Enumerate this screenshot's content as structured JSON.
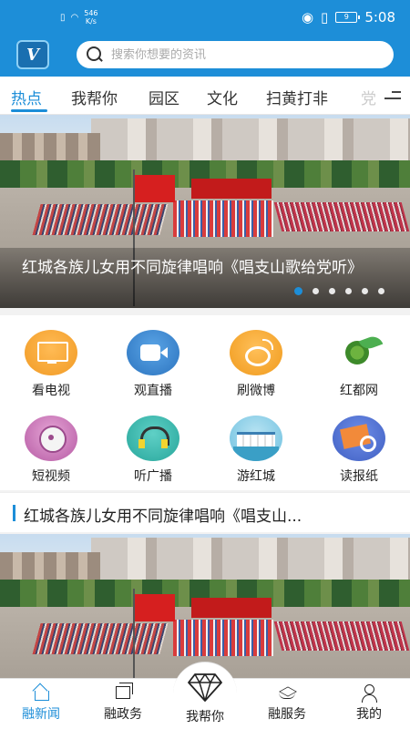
{
  "status_bar": {
    "speed_value": "546",
    "speed_unit": "K/s",
    "battery": "9",
    "time": "5:08"
  },
  "header": {
    "logo_icon": "app-logo",
    "search_placeholder": "搜索你想要的资讯"
  },
  "tabs": [
    "热点",
    "我帮你",
    "园区",
    "文化",
    "扫黄打非",
    "党"
  ],
  "banner": {
    "caption": "红城各族儿女用不同旋律唱响《唱支山歌给党听》",
    "slide_count": 6,
    "active_slide": 1
  },
  "shortcuts": [
    {
      "label": "看电视",
      "icon": "tv-icon"
    },
    {
      "label": "观直播",
      "icon": "video-camera-icon"
    },
    {
      "label": "刷微博",
      "icon": "weibo-icon"
    },
    {
      "label": "红都网",
      "icon": "leaf-globe-icon"
    },
    {
      "label": "短视频",
      "icon": "film-reel-icon"
    },
    {
      "label": "听广播",
      "icon": "headphones-icon"
    },
    {
      "label": "游红城",
      "icon": "city-landmark-icon"
    },
    {
      "label": "读报纸",
      "icon": "newspaper-icon"
    }
  ],
  "section": {
    "title": "红城各族儿女用不同旋律唱响《唱支山..."
  },
  "bottom_nav": {
    "items": [
      {
        "label": "融新闻",
        "icon": "home-icon"
      },
      {
        "label": "融政务",
        "icon": "windows-icon"
      },
      {
        "label": "我帮你",
        "icon": "diamond-icon"
      },
      {
        "label": "融服务",
        "icon": "layers-icon"
      },
      {
        "label": "我的",
        "icon": "user-icon"
      }
    ]
  },
  "colors": {
    "accent": "#1d8ed8"
  }
}
